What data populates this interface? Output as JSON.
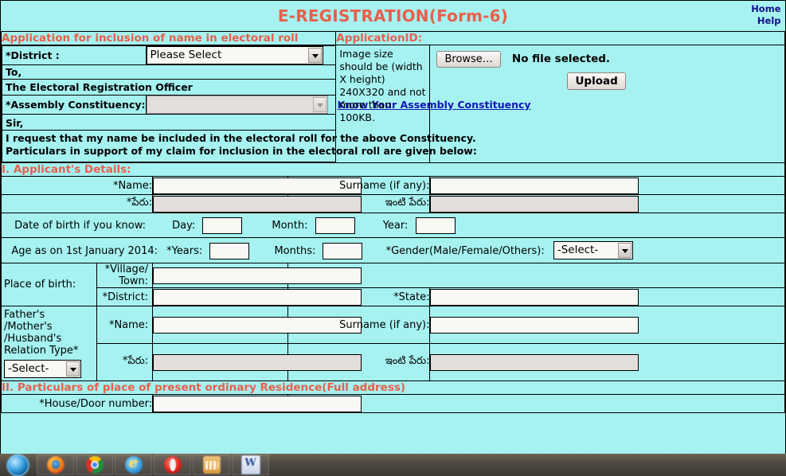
{
  "header": {
    "title": "E-REGISTRATION(Form-6)",
    "nav": [
      {
        "label": "Home"
      },
      {
        "label": "Help"
      }
    ]
  },
  "bands": {
    "application_band": "Application for inclusion of name in electoral roll",
    "application_id_label": "ApplicationID:",
    "section_1": "I. Applicant's Details:",
    "section_2": "II. Particulars of place of present ordinary Residence(Full address)"
  },
  "top_left": {
    "district_label": "*District :",
    "district_value": "Please Select",
    "to_label": "To,",
    "officer_label": "The Electoral Registration Officer",
    "assembly_label": "*Assembly Constituency:",
    "assembly_value": "",
    "know_link": "Know Your Assembly Constituency",
    "sir_label": "Sir,",
    "request_text": "I request that my name be included in the electoral roll for the above Constituency. Particulars in support of my claim for inclusion in the electoral roll are given below:"
  },
  "upload": {
    "image_note": "Image size should be (width X height) 240X320 and not more than 100KB.",
    "browse_label": "Browse…",
    "no_file_label": "No file selected.",
    "upload_label": "Upload"
  },
  "applicant": {
    "name_label": "*Name:",
    "name_value": "",
    "surname_label": "Surname (if any):",
    "surname_value": "",
    "name_te_label": "*పేరు:",
    "name_te_value": "",
    "surname_te_label": "ఇంటి పేరు:",
    "surname_te_value": "",
    "dob_label": "Date of birth if you know:",
    "day_label": "Day:",
    "day_value": "",
    "month_label": "Month:",
    "month_value": "",
    "year_label": "Year:",
    "year_value": "",
    "age_label": "Age as on 1st January 2014:",
    "years_label": "*Years:",
    "years_value": "",
    "months_label": "Months:",
    "months_value": "",
    "gender_label": "*Gender(Male/Female/Others):",
    "gender_value": "-Select-",
    "place_of_birth_label": "Place of birth:",
    "village_label": "*Village/ Town:",
    "village_value": "",
    "pob_district_label": "*District:",
    "pob_district_value": "",
    "state_label": "*State:",
    "state_value": "",
    "relation_type_label": "Father's /Mother's /Husband's Relation Type*",
    "relation_type_value": "-Select-",
    "rel_name_label": "*Name:",
    "rel_name_value": "",
    "rel_surname_label": "Surname (if any):",
    "rel_surname_value": "",
    "rel_name_te_label": "*పేరు:",
    "rel_name_te_value": "",
    "rel_surname_te_label": "ఇంటి పేరు:",
    "rel_surname_te_value": ""
  },
  "residence": {
    "house_label": "*House/Door number:",
    "house_value": ""
  },
  "taskbar": {
    "items": [
      {
        "name": "start-orb"
      },
      {
        "name": "firefox"
      },
      {
        "name": "chrome"
      },
      {
        "name": "internet-explorer"
      },
      {
        "name": "opera"
      },
      {
        "name": "media-player"
      },
      {
        "name": "microsoft-word"
      }
    ]
  },
  "colors": {
    "page_bg": "#a5f2f0",
    "accent_red": "#e8604c",
    "link_navy": "#14108c",
    "link_blue": "#1414b4",
    "input_bg": "#f9f8f5",
    "input_disabled_bg": "#e3dedb"
  }
}
